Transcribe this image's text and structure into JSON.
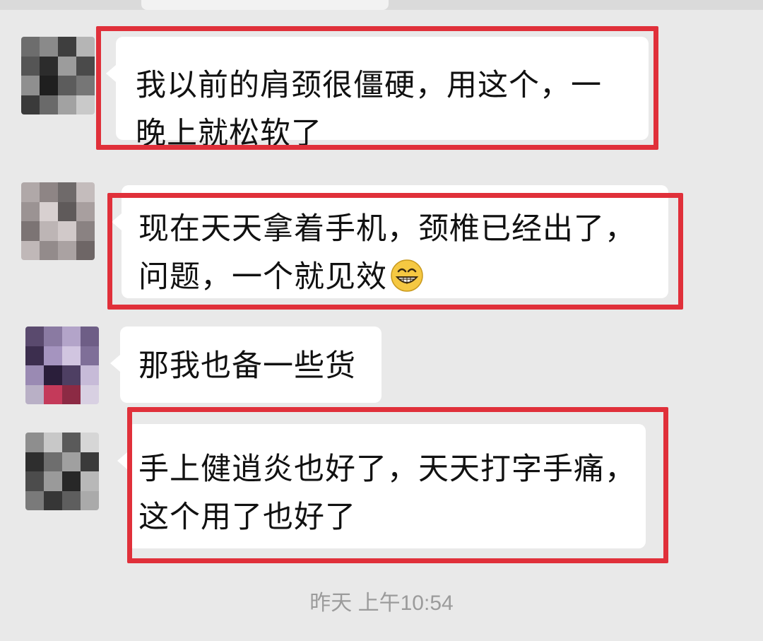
{
  "messages": [
    {
      "lines": [
        "我以前的肩颈很僵硬，用这个，一",
        "晚上就松软了"
      ],
      "highlighted": true
    },
    {
      "lines": [
        "现在天天拿着手机，颈椎已经出了，",
        "问题，一个就见效"
      ],
      "emoji": "grinning-face-icon",
      "highlighted": true
    },
    {
      "lines": [
        "那我也备一些货"
      ],
      "highlighted": false
    },
    {
      "lines": [
        "手上健逍炎也好了，天天打字手痛，",
        "这个用了也好了"
      ],
      "highlighted": true
    }
  ],
  "timestamp": "昨天 上午10:54",
  "colors": {
    "background": "#e9e9e9",
    "bubble": "#ffffff",
    "highlight_border": "#e0303a",
    "timestamp_text": "#9b9b9b"
  }
}
